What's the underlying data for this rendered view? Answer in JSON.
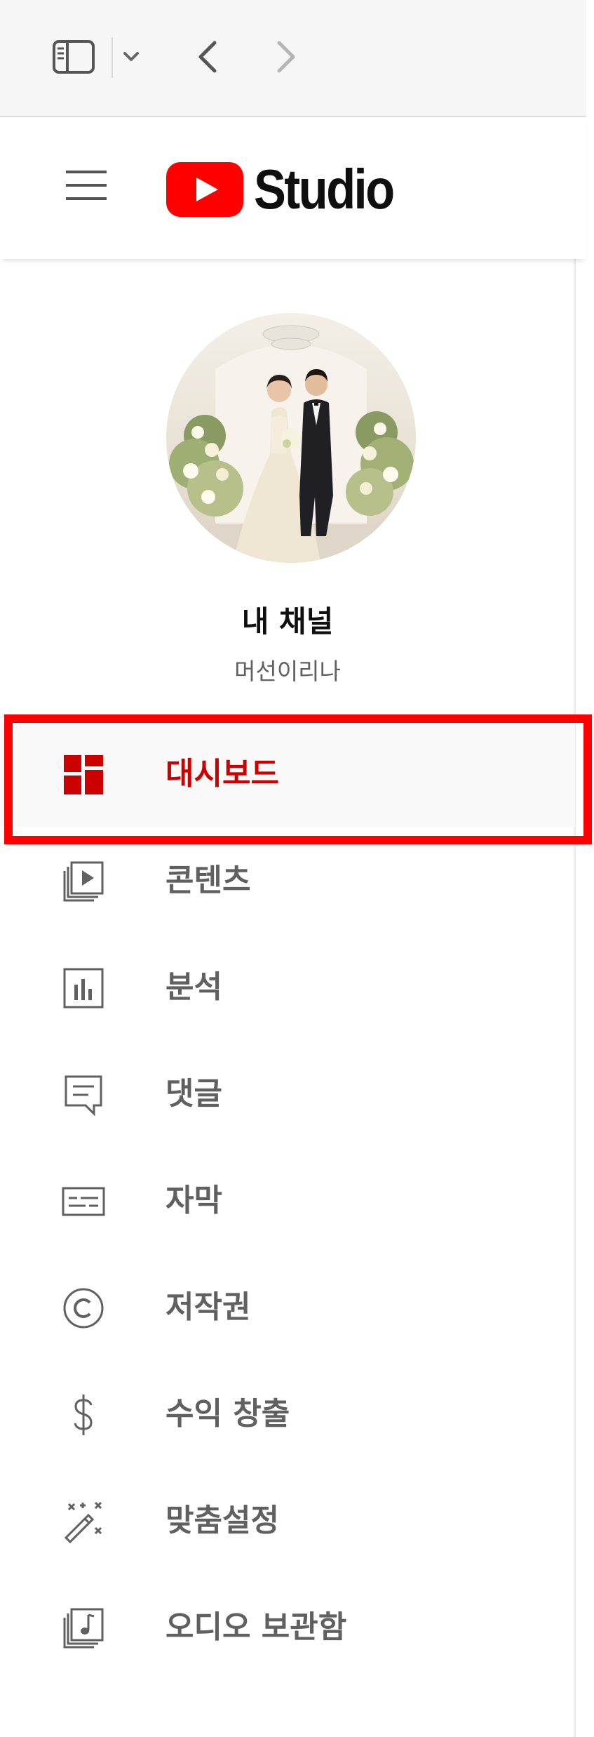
{
  "header": {
    "logo_text": "Studio",
    "brand_color": "#ff0000"
  },
  "icons": {
    "sidebar_toggle": "sidebar-toggle-icon",
    "dropdown": "chevron-down-icon",
    "back": "chevron-left-icon",
    "forward": "chevron-right-icon",
    "menu": "hamburger-menu-icon"
  },
  "channel": {
    "title": "내 채널",
    "name": "머선이리나"
  },
  "nav": [
    {
      "label": "대시보드",
      "icon": "dashboard-icon",
      "active": true
    },
    {
      "label": "콘텐츠",
      "icon": "video-library-icon",
      "active": false
    },
    {
      "label": "분석",
      "icon": "analytics-icon",
      "active": false
    },
    {
      "label": "댓글",
      "icon": "comment-icon",
      "active": false
    },
    {
      "label": "자막",
      "icon": "subtitles-icon",
      "active": false
    },
    {
      "label": "저작권",
      "icon": "copyright-icon",
      "active": false
    },
    {
      "label": "수익 창출",
      "icon": "dollar-icon",
      "active": false
    },
    {
      "label": "맞춤설정",
      "icon": "magic-wand-icon",
      "active": false
    },
    {
      "label": "오디오 보관함",
      "icon": "audio-library-icon",
      "active": false
    }
  ],
  "colors": {
    "active_text": "#cc0000",
    "inactive_text": "#606060",
    "highlight_border": "#ff0000"
  }
}
